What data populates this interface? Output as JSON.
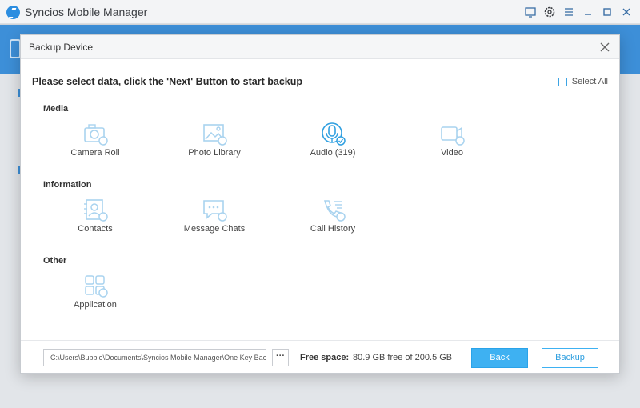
{
  "app": {
    "title": "Syncios Mobile Manager",
    "icons": [
      "monitor-icon",
      "gear-icon",
      "menu-icon",
      "minimize-icon",
      "maximize-icon",
      "close-icon"
    ]
  },
  "modal": {
    "title": "Backup Device",
    "instruction": "Please select data, click the 'Next' Button to start backup",
    "select_all": "Select All",
    "sections": [
      {
        "label": "Media",
        "items": [
          {
            "label": "Camera Roll",
            "icon": "camera-icon",
            "selected": false
          },
          {
            "label": "Photo Library",
            "icon": "image-icon",
            "selected": false
          },
          {
            "label": "Audio (319)",
            "icon": "microphone-icon",
            "selected": true
          },
          {
            "label": "Video",
            "icon": "video-camera-icon",
            "selected": false
          }
        ]
      },
      {
        "label": "Information",
        "items": [
          {
            "label": "Contacts",
            "icon": "contact-card-icon",
            "selected": false
          },
          {
            "label": "Message Chats",
            "icon": "chat-bubble-icon",
            "selected": false
          },
          {
            "label": "Call History",
            "icon": "phone-icon",
            "selected": false
          }
        ]
      },
      {
        "label": "Other",
        "items": [
          {
            "label": "Application",
            "icon": "app-grid-icon",
            "selected": false
          }
        ]
      }
    ],
    "footer": {
      "path": "C:\\Users\\Bubble\\Documents\\Syncios Mobile Manager\\One Key Bac",
      "more_label": "···",
      "free_space_label": "Free space:",
      "free_space_value": "80.9 GB free of 200.5 GB",
      "back_label": "Back",
      "backup_label": "Backup"
    }
  },
  "colors": {
    "accent": "#3eb1f2",
    "icon_idle": "#a9d3ef",
    "icon_active": "#2f9fe0",
    "band": "#3d8fd8"
  }
}
